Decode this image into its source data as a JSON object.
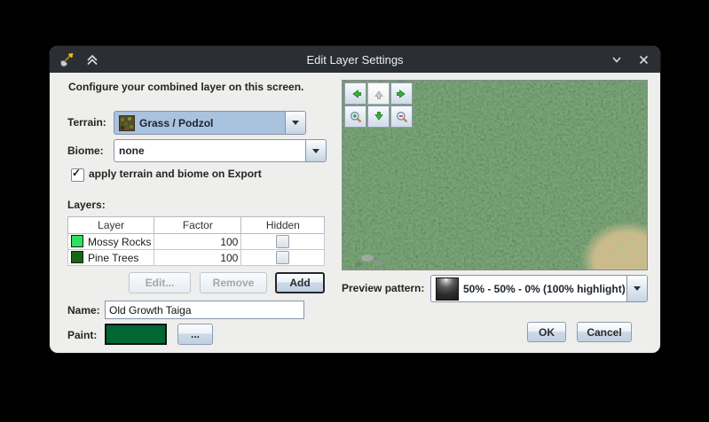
{
  "window": {
    "title": "Edit Layer Settings",
    "app_icon": "shovel",
    "controls": {
      "shade_up": "collapse",
      "roll_down": "roll-down",
      "close": "close"
    }
  },
  "intro": "Configure your combined layer on this screen.",
  "fields": {
    "terrain": {
      "label": "Terrain:",
      "value": "Grass / Podzol"
    },
    "biome": {
      "label": "Biome:",
      "value": "none"
    },
    "apply_export": {
      "label": "apply terrain and biome on Export",
      "checked": true
    },
    "name": {
      "label": "Name:",
      "value": "Old Growth Taiga"
    },
    "paint": {
      "label": "Paint:",
      "color": "#006634",
      "browse_label": "..."
    }
  },
  "layers": {
    "label": "Layers:",
    "columns": [
      "Layer",
      "Factor",
      "Hidden"
    ],
    "rows": [
      {
        "name": "Mossy Rocks",
        "factor": "100",
        "hidden": false,
        "color": "#2ee060"
      },
      {
        "name": "Pine Trees",
        "factor": "100",
        "hidden": false,
        "color": "#156615"
      }
    ],
    "buttons": {
      "edit": "Edit...",
      "remove": "Remove",
      "add": "Add"
    },
    "edit_enabled": false,
    "remove_enabled": false,
    "add_enabled": true
  },
  "preview": {
    "pattern_label": "Preview pattern:",
    "pattern_value": "50% - 50% - 0% (100% highlight)",
    "controls": [
      {
        "icon": "arrow-left",
        "enabled": true
      },
      {
        "icon": "arrow-up",
        "enabled": false
      },
      {
        "icon": "arrow-right",
        "enabled": true
      },
      {
        "icon": "zoom-in",
        "enabled": true
      },
      {
        "icon": "arrow-down",
        "enabled": true
      },
      {
        "icon": "zoom-out",
        "enabled": true
      }
    ]
  },
  "dialog_buttons": {
    "ok": "OK",
    "cancel": "Cancel"
  },
  "colors": {
    "titlebar": "#2b2f34",
    "dialog_bg": "#eeeeec",
    "focused_combo_bg": "#a9c2de",
    "forest_base": "#274327"
  }
}
